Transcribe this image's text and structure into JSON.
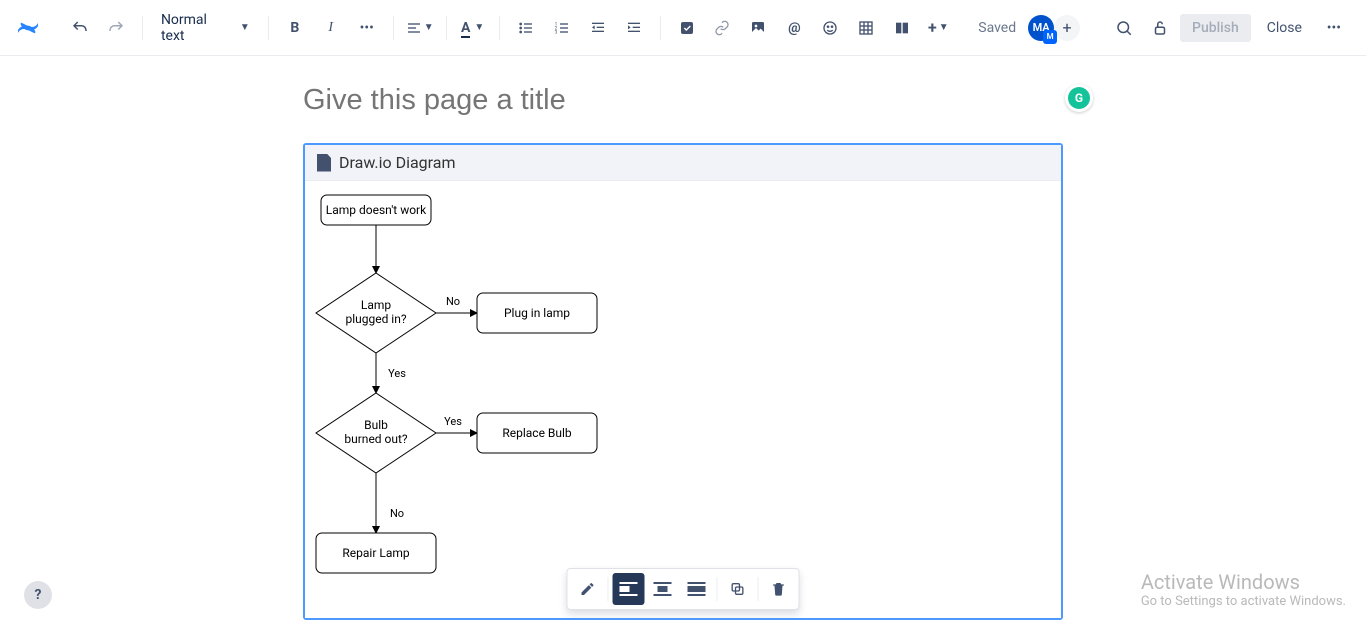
{
  "toolbar": {
    "text_style": "Normal text",
    "saved": "Saved",
    "publish": "Publish",
    "close": "Close",
    "avatar_initials": "MA",
    "avatar_badge": "M"
  },
  "page": {
    "title_placeholder": "Give this page a title"
  },
  "macro": {
    "title": "Draw.io Diagram"
  },
  "flowchart": {
    "node_start": "Lamp doesn't work",
    "node_d1_l1": "Lamp",
    "node_d1_l2": "plugged in?",
    "node_d2_l1": "Bulb",
    "node_d2_l2": "burned out?",
    "node_a1": "Plug in lamp",
    "node_a2": "Replace Bulb",
    "node_end": "Repair Lamp",
    "edge_no": "No",
    "edge_yes": "Yes"
  },
  "grammarly": {
    "letter": "G"
  },
  "help": {
    "symbol": "?"
  },
  "windows": {
    "line1": "Activate Windows",
    "line2": "Go to Settings to activate Windows."
  }
}
